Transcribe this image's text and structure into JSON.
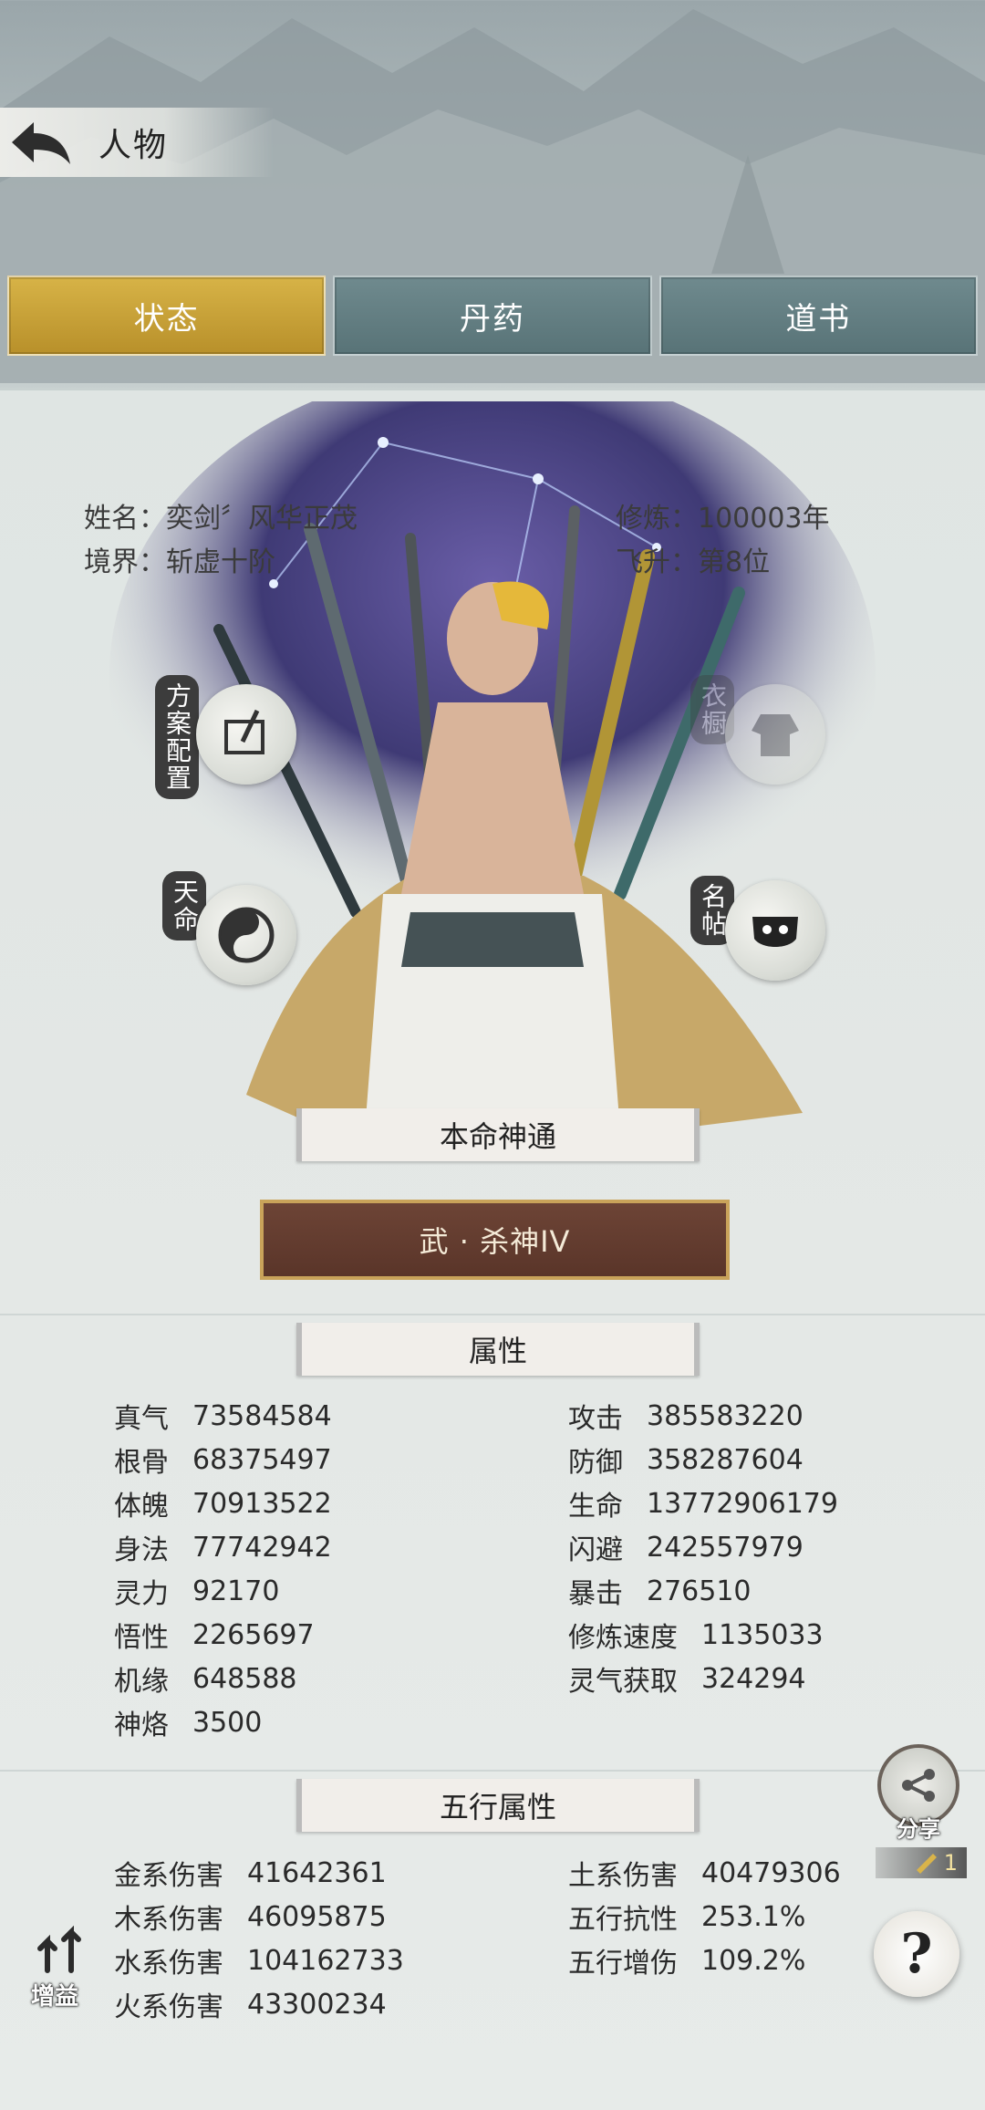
{
  "header": {
    "title": "人物"
  },
  "tabs": [
    {
      "label": "状态",
      "active": true
    },
    {
      "label": "丹药",
      "active": false
    },
    {
      "label": "道书",
      "active": false
    }
  ],
  "profile": {
    "name_label": "姓名：",
    "name": "奕剑〞风华正茂",
    "realm_label": "境界：",
    "realm": "斩虚十阶",
    "cultivation_label": "修炼：",
    "cultivation": "100003年",
    "ascension_label": "飞升：",
    "ascension": "第8位"
  },
  "side_buttons": {
    "plan": "方案配置",
    "fate": "天命",
    "clothes": "衣橱",
    "card": "名帖"
  },
  "natal": {
    "section_title": "本命神通",
    "skill": "武 · 杀神IV"
  },
  "attributes": {
    "section_title": "属性",
    "left": [
      {
        "label": "真气",
        "value": "73584584"
      },
      {
        "label": "根骨",
        "value": "68375497"
      },
      {
        "label": "体魄",
        "value": "70913522"
      },
      {
        "label": "身法",
        "value": "77742942"
      },
      {
        "label": "灵力",
        "value": "92170"
      },
      {
        "label": "悟性",
        "value": "2265697"
      },
      {
        "label": "机缘",
        "value": "648588"
      },
      {
        "label": "神烙",
        "value": "3500"
      }
    ],
    "right": [
      {
        "label": "攻击",
        "value": "385583220"
      },
      {
        "label": "防御",
        "value": "358287604"
      },
      {
        "label": "生命",
        "value": "13772906179"
      },
      {
        "label": "闪避",
        "value": "242557979"
      },
      {
        "label": "暴击",
        "value": "276510"
      },
      {
        "label": "修炼速度",
        "value": "1135033"
      },
      {
        "label": "灵气获取",
        "value": "324294"
      }
    ]
  },
  "elements": {
    "section_title": "五行属性",
    "left": [
      {
        "label": "金系伤害",
        "value": "41642361"
      },
      {
        "label": "木系伤害",
        "value": "46095875"
      },
      {
        "label": "水系伤害",
        "value": "104162733"
      },
      {
        "label": "火系伤害",
        "value": "43300234"
      }
    ],
    "right": [
      {
        "label": "土系伤害",
        "value": "40479306"
      },
      {
        "label": "五行抗性",
        "value": "253.1%"
      },
      {
        "label": "五行增伤",
        "value": "109.2%"
      }
    ]
  },
  "float_buttons": {
    "share": "分享",
    "ticket_count": "1",
    "help": "?",
    "buff": "增益"
  },
  "colors": {
    "tab_active": "#c9a33a",
    "tab_inactive": "#617c80",
    "skill_bg": "#5f3a2d"
  }
}
